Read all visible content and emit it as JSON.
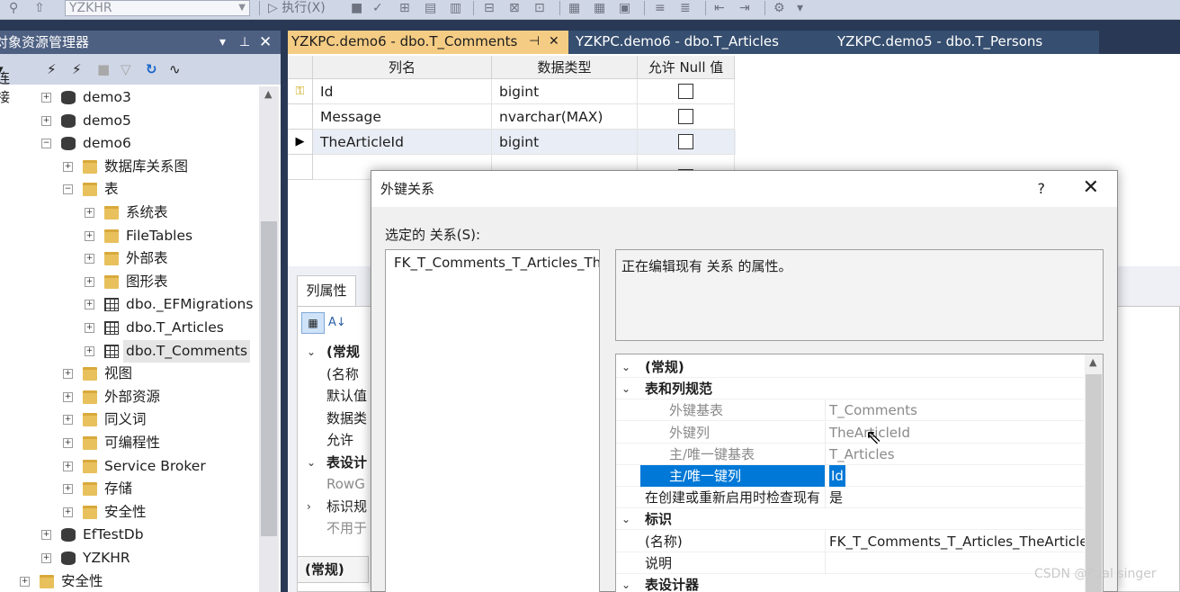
{
  "toolbar": {
    "server_combo": "YZKHR",
    "execute_label": "执行(X)"
  },
  "explorer": {
    "title": "对象资源管理器",
    "connect_label": "连接",
    "tree": [
      {
        "label": "demo3",
        "icon": "database-icon",
        "toggle": "+"
      },
      {
        "label": "demo5",
        "icon": "database-icon",
        "toggle": "+"
      },
      {
        "label": "demo6",
        "icon": "database-icon",
        "toggle": "−"
      },
      {
        "label": "数据库关系图",
        "icon": "folder-icon",
        "toggle": "+"
      },
      {
        "label": "表",
        "icon": "folder-icon",
        "toggle": "−"
      },
      {
        "label": "系统表",
        "icon": "folder-icon",
        "toggle": "+"
      },
      {
        "label": "FileTables",
        "icon": "folder-icon",
        "toggle": "+"
      },
      {
        "label": "外部表",
        "icon": "folder-icon",
        "toggle": "+"
      },
      {
        "label": "图形表",
        "icon": "folder-icon",
        "toggle": "+"
      },
      {
        "label": "dbo._EFMigrations",
        "icon": "table-icon",
        "toggle": "+"
      },
      {
        "label": "dbo.T_Articles",
        "icon": "table-icon",
        "toggle": "+"
      },
      {
        "label": "dbo.T_Comments",
        "icon": "table-icon",
        "toggle": "+"
      },
      {
        "label": "视图",
        "icon": "folder-icon",
        "toggle": "+"
      },
      {
        "label": "外部资源",
        "icon": "folder-icon",
        "toggle": "+"
      },
      {
        "label": "同义词",
        "icon": "folder-icon",
        "toggle": "+"
      },
      {
        "label": "可编程性",
        "icon": "folder-icon",
        "toggle": "+"
      },
      {
        "label": "Service Broker",
        "icon": "folder-icon",
        "toggle": "+"
      },
      {
        "label": "存储",
        "icon": "folder-icon",
        "toggle": "+"
      },
      {
        "label": "安全性",
        "icon": "folder-icon",
        "toggle": "+"
      },
      {
        "label": "EfTestDb",
        "icon": "database-icon",
        "toggle": "+"
      },
      {
        "label": "YZKHR",
        "icon": "database-icon",
        "toggle": "+"
      },
      {
        "label": "安全性",
        "icon": "folder-icon",
        "toggle": "+"
      }
    ]
  },
  "tabs": [
    {
      "label": "YZKPC.demo6 - dbo.T_Comments",
      "active": true
    },
    {
      "label": "YZKPC.demo6 - dbo.T_Articles",
      "active": false
    },
    {
      "label": "YZKPC.demo5 - dbo.T_Persons",
      "active": false
    }
  ],
  "designer": {
    "headers": [
      "列名",
      "数据类型",
      "允许 Null 值"
    ],
    "rows": [
      {
        "name": "Id",
        "type": "bigint",
        "nullable": false,
        "marker": "key-icon"
      },
      {
        "name": "Message",
        "type": "nvarchar(MAX)",
        "nullable": false,
        "marker": ""
      },
      {
        "name": "TheArticleId",
        "type": "bigint",
        "nullable": false,
        "marker": "current-row-icon"
      },
      {
        "name": "",
        "type": "",
        "nullable": false,
        "marker": ""
      }
    ]
  },
  "column_props": {
    "tab_label": "列属性",
    "rows": [
      "(常规",
      "(名称",
      "默认值",
      "数据类",
      "允许",
      "表设计",
      "RowG",
      "标识规",
      "不用于"
    ],
    "bottom_label": "(常规)"
  },
  "dialog": {
    "title": "外键关系",
    "help": "?",
    "selected_label": "选定的 关系(S):",
    "relationships": [
      "FK_T_Comments_T_Articles_TheArticleId"
    ],
    "description": "正在编辑现有 关系 的属性。",
    "properties": [
      {
        "kind": "cat",
        "name": "(常规)",
        "value": ""
      },
      {
        "kind": "cat2",
        "name": "表和列规范",
        "value": ""
      },
      {
        "kind": "sub",
        "name": "外键基表",
        "value": "T_Comments"
      },
      {
        "kind": "sub",
        "name": "外键列",
        "value": "TheArticleId"
      },
      {
        "kind": "sub",
        "name": "主/唯一键基表",
        "value": "T_Articles"
      },
      {
        "kind": "sel",
        "name": "主/唯一键列",
        "value": "Id"
      },
      {
        "kind": "plain",
        "name": "在创建或重新启用时检查现有",
        "value": "是"
      },
      {
        "kind": "cat",
        "name": "标识",
        "value": ""
      },
      {
        "kind": "plain",
        "name": "(名称)",
        "value": "FK_T_Comments_T_Articles_TheArticleId"
      },
      {
        "kind": "plain",
        "name": "说明",
        "value": ""
      },
      {
        "kind": "cat",
        "name": "表设计器",
        "value": ""
      }
    ]
  },
  "watermark": "CSDN @Pual singer",
  "colors": {
    "active_tab": "#f5cc84",
    "selection": "#0078d7",
    "chrome": "#293955"
  }
}
